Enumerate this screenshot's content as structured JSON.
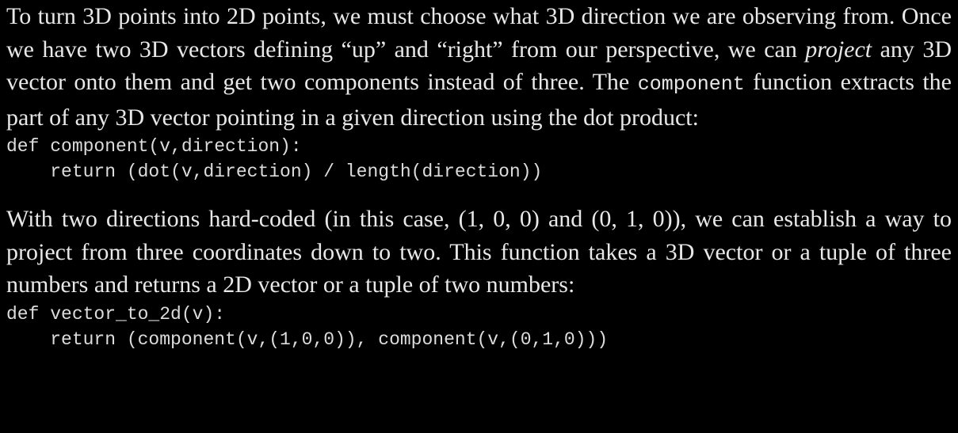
{
  "paragraph1": {
    "part1": "To turn 3D points into 2D points, we must choose what 3D direction we are observing from. Once we have two 3D vectors defining “up” and “right” from our perspective, we can ",
    "emphasis": "project",
    "part2": " any 3D vector onto them and get two components instead of three. The ",
    "code": "component",
    "part3": " function extracts the part of any 3D vector pointing in a given direction using the dot product:"
  },
  "code_block1": {
    "line1": "def component(v,direction):",
    "line2": "    return (dot(v,direction) / length(direction))"
  },
  "paragraph2": {
    "text": "With two directions hard-coded (in this case, (1, 0, 0) and (0, 1, 0)), we can establish a way to project from three coordinates down to two. This function takes a 3D vector or a tuple of three numbers and returns a 2D vector or a tuple of two numbers:"
  },
  "code_block2": {
    "line1": "def vector_to_2d(v):",
    "line2": "    return (component(v,(1,0,0)), component(v,(0,1,0)))"
  }
}
